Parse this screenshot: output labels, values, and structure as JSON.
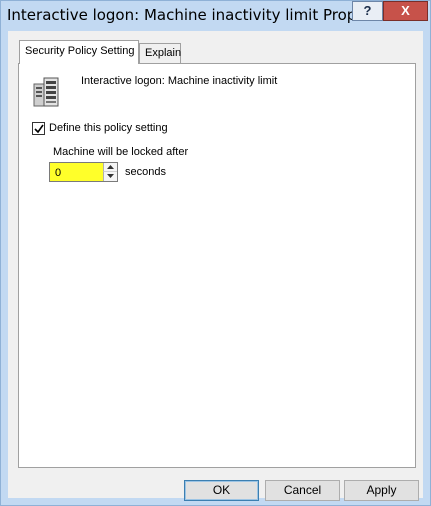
{
  "window": {
    "title": "Interactive logon: Machine inactivity limit Properti...",
    "help_label": "?",
    "close_label": "X"
  },
  "tabs": [
    {
      "label": "Security Policy Setting",
      "active": true
    },
    {
      "label": "Explain",
      "active": false
    }
  ],
  "policy": {
    "icon": "server-icon",
    "name": "Interactive logon: Machine inactivity limit",
    "define_label": "Define this policy setting",
    "define_checked": true,
    "locked_label": "Machine will be locked after",
    "value": "0",
    "unit": "seconds"
  },
  "buttons": {
    "ok": "OK",
    "cancel": "Cancel",
    "apply": "Apply"
  },
  "colors": {
    "highlight": "#ffff2a",
    "close_button": "#c7524a",
    "frame": "#c2d9f2"
  }
}
